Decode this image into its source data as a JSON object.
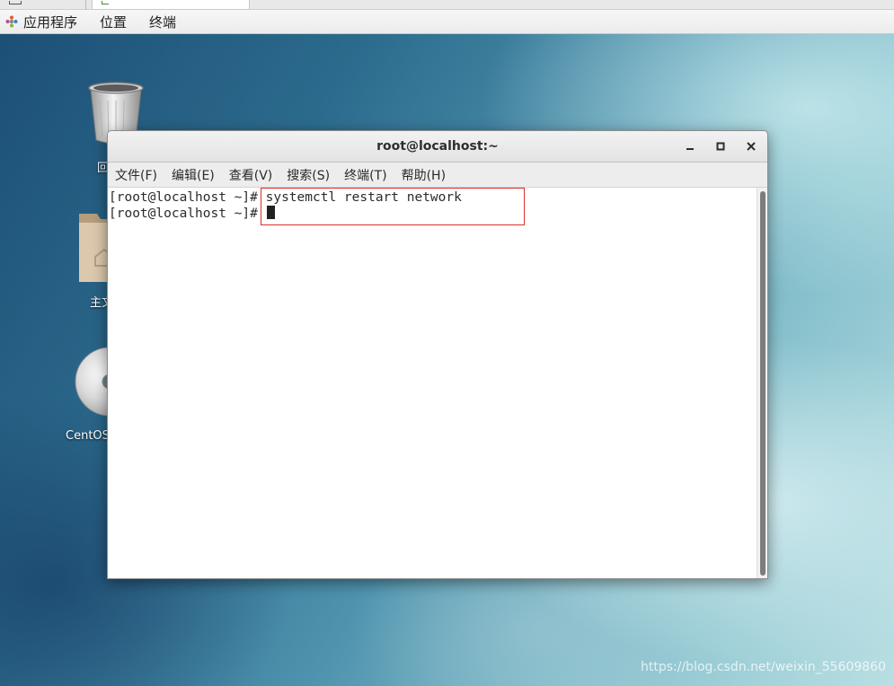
{
  "top_panel": {
    "items": [
      "应用程序",
      "位置",
      "终端"
    ]
  },
  "desktop": {
    "icons": [
      {
        "label": "回",
        "icon": "trash-icon"
      },
      {
        "label": "主文",
        "icon": "home-folder-icon"
      },
      {
        "label": "CentOS",
        "icon": "cd-disc-icon"
      }
    ]
  },
  "terminal": {
    "title": "root@localhost:~",
    "menu": [
      "文件(F)",
      "编辑(E)",
      "查看(V)",
      "搜索(S)",
      "终端(T)",
      "帮助(H)"
    ],
    "lines": [
      {
        "prompt": "[root@localhost ~]#",
        "command": " systemctl restart network"
      },
      {
        "prompt": "[root@localhost ~]#",
        "command": " "
      }
    ],
    "highlight_color": "#d9302c"
  },
  "watermark": "https://blog.csdn.net/weixin_55609860"
}
